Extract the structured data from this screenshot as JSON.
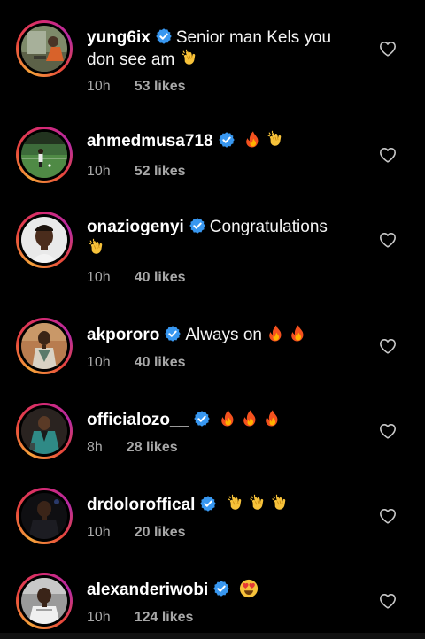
{
  "comments": [
    {
      "username": "yung6ix",
      "text_line1": "Senior man Kels you",
      "text_line2": "don see am",
      "emojis": [
        "clap"
      ],
      "time": "10h",
      "likes": "53 likes",
      "avatar": "avatar-photo-outdoor"
    },
    {
      "username": "ahmedmusa718",
      "text_line1": "",
      "emojis": [
        "fire",
        "clap"
      ],
      "time": "10h",
      "likes": "52 likes",
      "avatar": "avatar-photo-football-pitch"
    },
    {
      "username": "onaziogenyi",
      "text_line1": "Congratulations",
      "emojis": [
        "clap"
      ],
      "time": "10h",
      "likes": "40 likes",
      "avatar": "avatar-photo-portrait"
    },
    {
      "username": "akpororo",
      "text_line1": "Always on",
      "emojis": [
        "fire",
        "fire"
      ],
      "time": "10h",
      "likes": "40 likes",
      "avatar": "avatar-photo-suit"
    },
    {
      "username": "officialozo__",
      "text_line1": "",
      "emojis": [
        "fire",
        "fire",
        "fire"
      ],
      "time": "8h",
      "likes": "28 likes",
      "avatar": "avatar-photo-teal-suit"
    },
    {
      "username": "drdoloroffical",
      "text_line1": "",
      "emojis": [
        "clap",
        "clap",
        "clap"
      ],
      "time": "10h",
      "likes": "20 likes",
      "avatar": "avatar-photo-dark"
    },
    {
      "username": "alexanderiwobi",
      "text_line1": "",
      "emojis": [
        "heart-eyes"
      ],
      "time": "10h",
      "likes": "124 likes",
      "avatar": "avatar-photo-white-top"
    }
  ],
  "colors": {
    "verified": "#3897f0",
    "meta": "#a8a8a8",
    "background": "#000000"
  }
}
